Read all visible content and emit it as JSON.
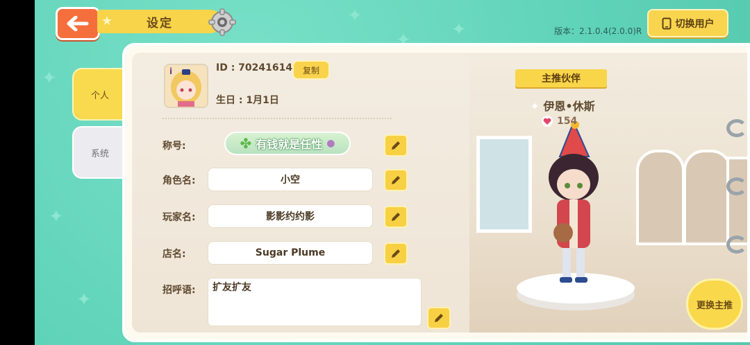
{
  "header": {
    "title": "设定",
    "version": "版本：2.1.0.4(2.0.0)R",
    "switch_user_label": "切换用户"
  },
  "tabs": [
    {
      "label": "个人",
      "active": true
    },
    {
      "label": "系统",
      "active": false
    }
  ],
  "profile": {
    "id_text": "ID : 70241614",
    "copy_label": "复制",
    "birthday": "生日 : 1月1日"
  },
  "fields": {
    "title_label": "称号:",
    "title_badge": "有钱就是任性",
    "role_label": "角色名:",
    "role_value": "小空",
    "player_label": "玩家名:",
    "player_value": "影影约约影",
    "shop_label": "店名:",
    "shop_value": "Sugar Plume",
    "greeting_label": "招呼语:",
    "greeting_value": "扩友扩友"
  },
  "partner": {
    "banner": "主推伙伴",
    "name": "伊恩•休斯",
    "affection": "154",
    "change_label": "更换主推"
  },
  "colors": {
    "background": "#5fd3b8",
    "accent_yellow": "#f9d54f",
    "back_orange": "#f56f3c"
  }
}
